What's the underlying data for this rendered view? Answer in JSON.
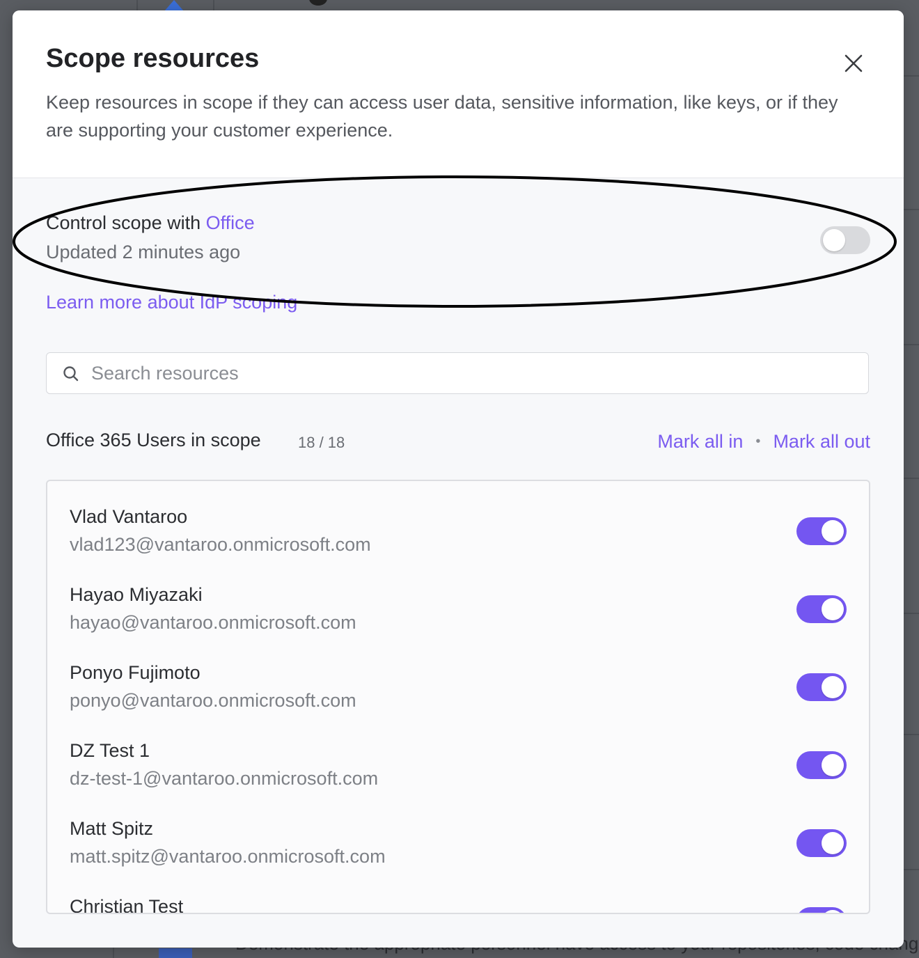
{
  "modal": {
    "title": "Scope resources",
    "description": "Keep resources in scope if they can access user data, sensitive information, like keys, or if they are supporting your customer experience."
  },
  "scope_control": {
    "label": "Control scope with",
    "provider": "Office",
    "updated": "Updated 2 minutes ago",
    "enabled": false
  },
  "learn_more": {
    "label": "Learn more about IdP scoping"
  },
  "search": {
    "placeholder": "Search resources",
    "value": ""
  },
  "list": {
    "heading": "Office 365 Users in scope",
    "count": "18 / 18",
    "mark_all_in": "Mark all in",
    "separator": "•",
    "mark_all_out": "Mark all out",
    "users": [
      {
        "name": "Vlad Vantaroo",
        "email": "vlad123@vantaroo.onmicrosoft.com",
        "in_scope": true
      },
      {
        "name": "Hayao Miyazaki",
        "email": "hayao@vantaroo.onmicrosoft.com",
        "in_scope": true
      },
      {
        "name": "Ponyo Fujimoto",
        "email": "ponyo@vantaroo.onmicrosoft.com",
        "in_scope": true
      },
      {
        "name": "DZ Test 1",
        "email": "dz-test-1@vantaroo.onmicrosoft.com",
        "in_scope": true
      },
      {
        "name": "Matt Spitz",
        "email": "matt.spitz@vantaroo.onmicrosoft.com",
        "in_scope": true
      },
      {
        "name": "Christian Test",
        "email": "",
        "in_scope": true
      }
    ]
  },
  "colors": {
    "accent": "#7456f1",
    "link": "#7b5cf0",
    "toggle_off": "#d9dadd"
  },
  "background": {
    "partial_text": "Demonstrate the appropriate personnel have access to your repositories, code change"
  }
}
